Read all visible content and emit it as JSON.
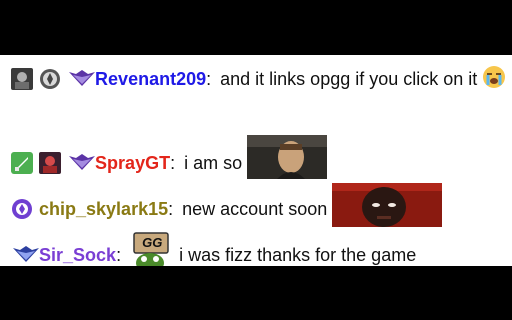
{
  "messages": [
    {
      "username": "Revenant209",
      "color": "#1f1ae6",
      "text": "and it links opgg if you click on it",
      "badges": [
        "avatar-badge",
        "medal-badge",
        "wings-badge"
      ],
      "emote": "loudly-crying-face"
    },
    {
      "username": "SprayGT",
      "color": "#e3261b",
      "text": "i am so",
      "badges": [
        "sword-badge",
        "profile-badge",
        "wings-badge"
      ],
      "emote": "photo-emote"
    },
    {
      "username": "chip_skylark15",
      "color": "#8a7a14",
      "text": "new account soon",
      "badges": [
        "circle-badge"
      ],
      "emote": "face-emote"
    },
    {
      "username": "Sir_Sock",
      "color": "#7a3fd4",
      "text": "i was fizz thanks for the game",
      "badges": [
        "wings-badge"
      ],
      "emote": "gg-frog-emote",
      "emote_text": "GG"
    }
  ],
  "colon": ":",
  "colors": {
    "chat_bg": "#ffffff",
    "frame_bg": "#000000"
  }
}
